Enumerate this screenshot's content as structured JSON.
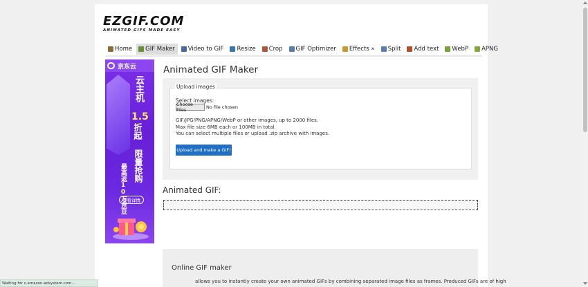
{
  "logo": {
    "main": "EZGIF.COM",
    "tagline": "ANIMATED GIFS MADE EASY"
  },
  "nav": [
    {
      "label": "Home",
      "icon": "home-icon",
      "color": "#8a6d3b"
    },
    {
      "label": "GIF Maker",
      "icon": "gif-maker-icon",
      "color": "#6a8f3a",
      "active": true
    },
    {
      "label": "Video to GIF",
      "icon": "video-icon",
      "color": "#4a6a9a"
    },
    {
      "label": "Resize",
      "icon": "resize-icon",
      "color": "#3a77b5"
    },
    {
      "label": "Crop",
      "icon": "crop-icon",
      "color": "#b5553a"
    },
    {
      "label": "GIF Optimizer",
      "icon": "optimizer-icon",
      "color": "#5a7fa8"
    },
    {
      "label": "Effects »",
      "icon": "effects-icon",
      "color": "#c99a2e"
    },
    {
      "label": "Split",
      "icon": "split-icon",
      "color": "#5b7fb0"
    },
    {
      "label": "Add text",
      "icon": "add-text-icon",
      "color": "#b2502f"
    },
    {
      "label": "WebP",
      "icon": "webp-icon",
      "color": "#7aa23a"
    },
    {
      "label": "APNG",
      "icon": "apng-icon",
      "color": "#86a83c"
    }
  ],
  "ad": {
    "logo": "京东云",
    "line1": "云主机",
    "big": "1.5",
    "line2": "折起",
    "line3": "最高返10万京豆",
    "line4": "限量抢购",
    "button": "查看详情"
  },
  "main": {
    "title": "Animated GIF Maker",
    "upload": {
      "legend": "Upload images",
      "select_label": "Select images:",
      "choose_button": "Choose Files",
      "no_file": "No file chosen",
      "info1": "GIF/JPG/PNG/APNG/WebP or other images, up to 2000 files.",
      "info2": "Max file size 6MB each or 100MB in total.",
      "info3": "You can select multiple files or upload .zip archive with images.",
      "submit": "Upload and make a GIF!"
    },
    "gif_title": "Animated GIF:",
    "online_title": "Online GIF maker",
    "online_text": "allows you to instantly create your own animated GIFs by combining separated image files as frames. Produced GIFs are of high"
  },
  "status": "Waiting for c.amazon-adsystem.com..."
}
